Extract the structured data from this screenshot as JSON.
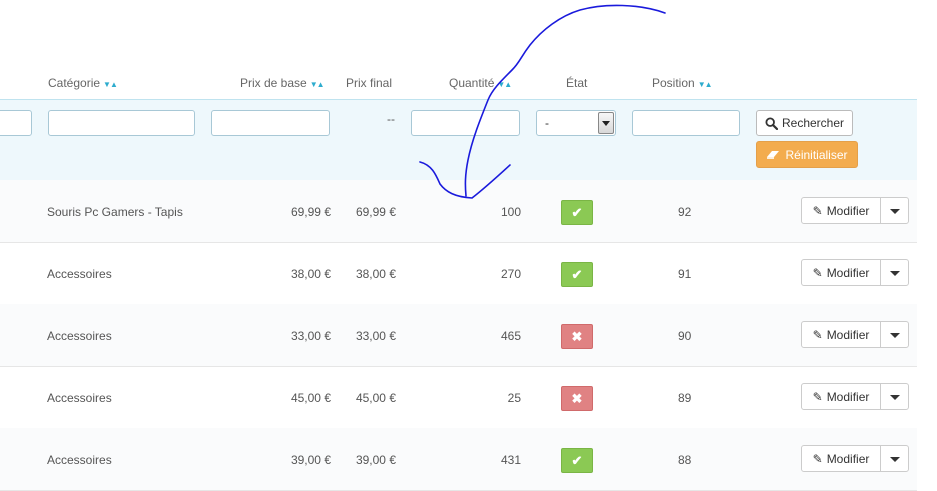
{
  "columns": {
    "category": "Catégorie",
    "base_price": "Prix de base",
    "final_price": "Prix final",
    "quantity": "Quantité",
    "state": "État",
    "position": "Position"
  },
  "sort_indicator": "▼▲",
  "filters": {
    "final_price_placeholder": "--",
    "state_select_value": "-",
    "search_label": "Rechercher",
    "reset_label": "Réinitialiser"
  },
  "rows": [
    {
      "category": "Souris Pc Gamers - Tapis",
      "base_price": "69,99 €",
      "final_price": "69,99 €",
      "quantity": "100",
      "state": "enabled",
      "state_icon": "✔",
      "position": "92",
      "action": "Modifier"
    },
    {
      "category": "Accessoires",
      "base_price": "38,00 €",
      "final_price": "38,00 €",
      "quantity": "270",
      "state": "enabled",
      "state_icon": "✔",
      "position": "91",
      "action": "Modifier"
    },
    {
      "category": "Accessoires",
      "base_price": "33,00 €",
      "final_price": "33,00 €",
      "quantity": "465",
      "state": "disabled",
      "state_icon": "✖",
      "position": "90",
      "action": "Modifier"
    },
    {
      "category": "Accessoires",
      "base_price": "45,00 €",
      "final_price": "45,00 €",
      "quantity": "25",
      "state": "disabled",
      "state_icon": "✖",
      "position": "89",
      "action": "Modifier"
    },
    {
      "category": "Accessoires",
      "base_price": "39,00 €",
      "final_price": "39,00 €",
      "quantity": "431",
      "state": "enabled",
      "state_icon": "✔",
      "position": "88",
      "action": "Modifier"
    }
  ],
  "icons": {
    "search": "search-icon",
    "eraser": "eraser-icon",
    "pencil": "pencil-icon",
    "caret": "chevron-down-icon",
    "check": "check-icon",
    "cross": "close-icon"
  },
  "colors": {
    "enabled": "#8bc954",
    "disabled": "#e08283",
    "reset_button": "#f3ac4e",
    "filter_row": "#eef8fc",
    "annotation": "#1a1adc"
  }
}
